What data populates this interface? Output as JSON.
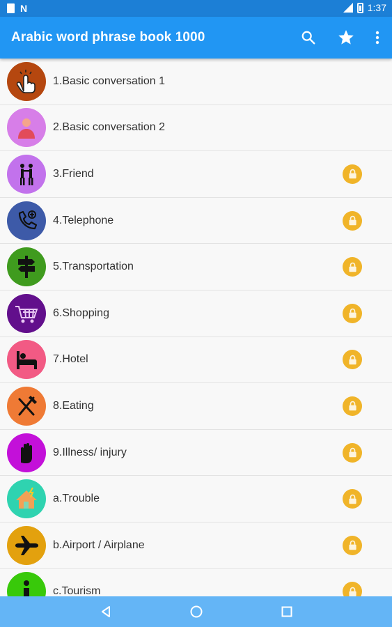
{
  "status_bar": {
    "time": "1:37"
  },
  "app_bar": {
    "title": "Arabic word phrase book 1000",
    "actions": [
      "search-icon",
      "star-icon",
      "more-vert-icon"
    ]
  },
  "colors": {
    "primary": "#2196f3",
    "status": "#1c7fd6",
    "nav": "#64b5f6",
    "lock": "#f0b429"
  },
  "list": {
    "items": [
      {
        "label": "1.Basic conversation 1",
        "icon": "pointing-hand-icon",
        "color": "#b5470f",
        "locked": false
      },
      {
        "label": "2.Basic conversation 2",
        "icon": "person-icon",
        "color": "#d77ee8",
        "locked": false
      },
      {
        "label": "3.Friend",
        "icon": "friends-icon",
        "color": "#c272ec",
        "locked": true
      },
      {
        "label": "4.Telephone",
        "icon": "telephone-icon",
        "color": "#3d5aa8",
        "locked": true
      },
      {
        "label": "5.Transportation",
        "icon": "signpost-icon",
        "color": "#3f9b1e",
        "locked": true
      },
      {
        "label": "6.Shopping",
        "icon": "shopping-cart-icon",
        "color": "#620f8c",
        "locked": true
      },
      {
        "label": "7.Hotel",
        "icon": "bed-icon",
        "color": "#f25a84",
        "locked": true
      },
      {
        "label": "8.Eating",
        "icon": "fork-knife-icon",
        "color": "#ef7a35",
        "locked": true
      },
      {
        "label": "9.Illness/ injury",
        "icon": "hand-icon",
        "color": "#c310d9",
        "locked": true
      },
      {
        "label": "a.Trouble",
        "icon": "house-icon",
        "color": "#2fd3b0",
        "locked": true
      },
      {
        "label": "b.Airport / Airplane",
        "icon": "airplane-icon",
        "color": "#e3a10e",
        "locked": true
      },
      {
        "label": "c.Tourism",
        "icon": "info-icon",
        "color": "#38c90a",
        "locked": true
      }
    ]
  },
  "nav_bar": {
    "buttons": [
      "back-icon",
      "home-icon",
      "recents-icon"
    ]
  }
}
